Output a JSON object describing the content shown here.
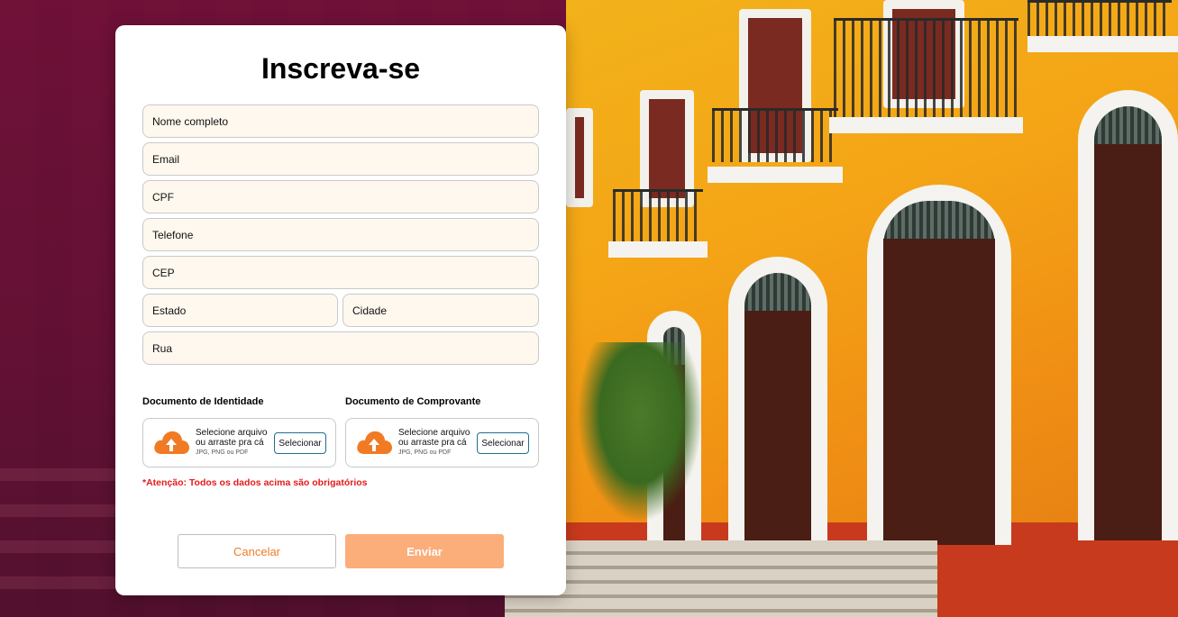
{
  "form": {
    "title": "Inscreva-se",
    "fields": {
      "nome": "Nome completo",
      "email": "Email",
      "cpf": "CPF",
      "telefone": "Telefone",
      "cep": "CEP",
      "estado": "Estado",
      "cidade": "Cidade",
      "rua": "Rua"
    },
    "uploads": [
      {
        "label": "Documento de Identidade",
        "line1": "Selecione arquivo",
        "line2": "ou arraste pra cá",
        "formats": "JPG, PNG ou PDF",
        "button": "Selecionar"
      },
      {
        "label": "Documento de Comprovante",
        "line1": "Selecione arquivo",
        "line2": "ou arraste pra cá",
        "formats": "JPG, PNG ou PDF",
        "button": "Selecionar"
      }
    ],
    "warning": "*Atenção: Todos os dados acima são obrigatórios",
    "cancel_label": "Cancelar",
    "submit_label": "Enviar"
  },
  "colors": {
    "accent": "#f07b24",
    "submit_bg": "#fbae7a",
    "field_bg": "#fff8ee",
    "warning": "#e31b1b",
    "select_border": "#1f6f8b"
  },
  "icons": {
    "upload": "cloud-upload-icon"
  }
}
